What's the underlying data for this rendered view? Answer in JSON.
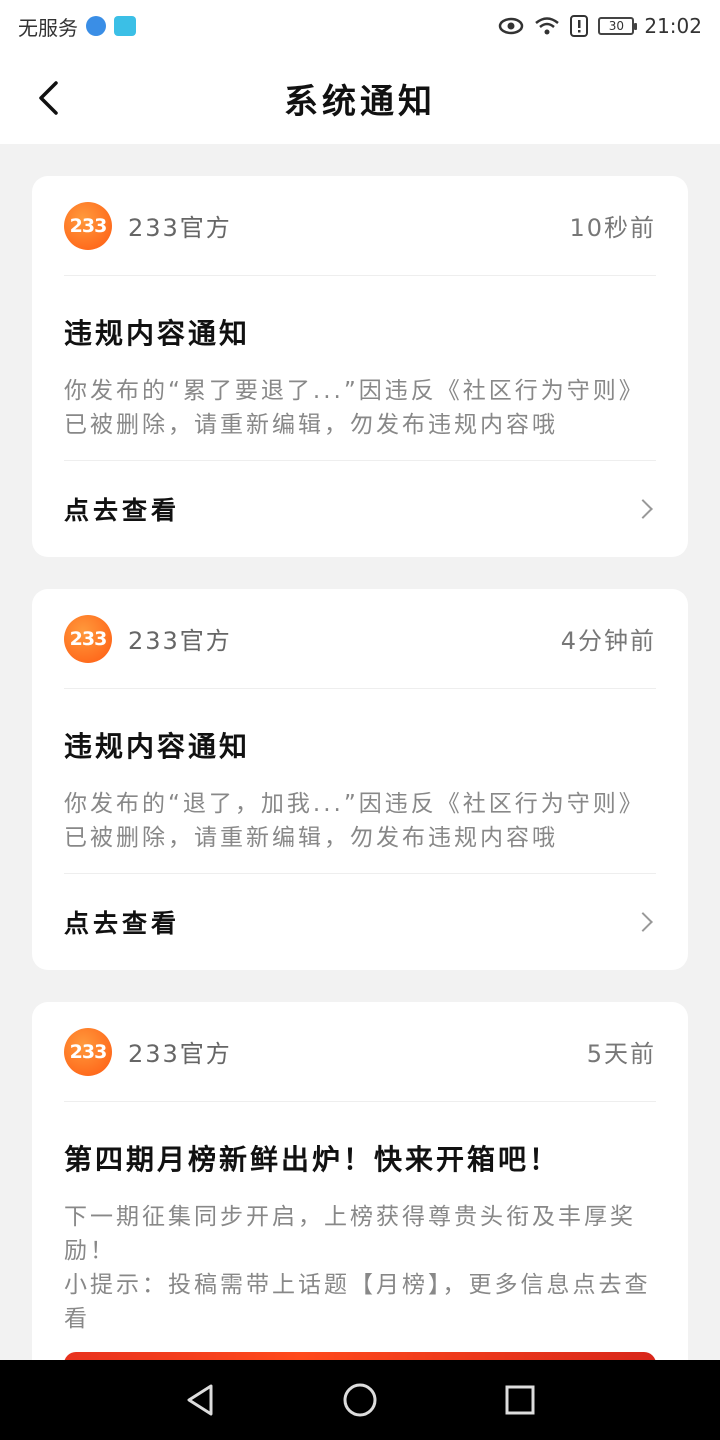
{
  "status_bar": {
    "carrier": "无服务",
    "battery": "30",
    "time": "21:02"
  },
  "header": {
    "title": "系统通知"
  },
  "notifications": [
    {
      "sender": "233官方",
      "avatar_text": "233",
      "time": "10秒前",
      "title": "违规内容通知",
      "content": "你发布的“累了要退了...”因违反《社区行为守则》已被删除，请重新编辑，勿发布违规内容哦",
      "action": "点去查看"
    },
    {
      "sender": "233官方",
      "avatar_text": "233",
      "time": "4分钟前",
      "title": "违规内容通知",
      "content": "你发布的“退了，加我...”因违反《社区行为守则》已被删除，请重新编辑，勿发布违规内容哦",
      "action": "点去查看"
    },
    {
      "sender": "233官方",
      "avatar_text": "233",
      "time": "5天前",
      "title": "第四期月榜新鲜出炉！快来开箱吧！",
      "content_line1": "下一期征集同步开启，上榜获得尊贵头衔及丰厚奖励！",
      "content_line2": "小提示：投稿需带上话题【月榜】，更多信息点去查看"
    }
  ],
  "colors": {
    "avatar": "#ff5a12",
    "banner": "#e8321e",
    "background": "#f2f2f2"
  },
  "icons": {
    "back": "chevron-left-icon",
    "row_arrow": "chevron-right-icon",
    "nav_back": "triangle-back-icon",
    "nav_home": "circle-home-icon",
    "nav_recent": "square-recent-icon"
  }
}
